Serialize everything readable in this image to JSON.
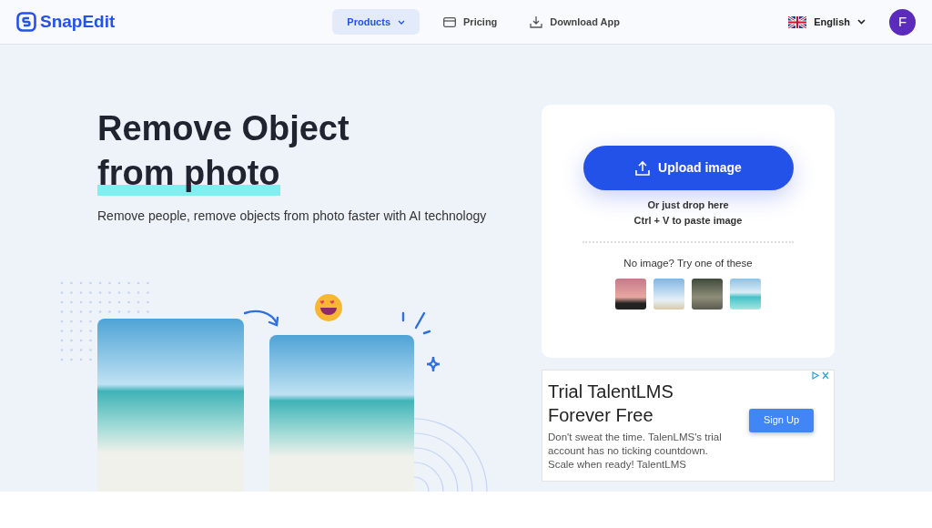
{
  "logo": {
    "text": "SnapEdit"
  },
  "nav": [
    {
      "label": "Products",
      "selected": true,
      "kind": "dropdown"
    },
    {
      "label": "Pricing",
      "selected": false,
      "kind": "card"
    },
    {
      "label": "Download App",
      "selected": false,
      "kind": "download"
    }
  ],
  "language": {
    "label": "English"
  },
  "avatar": {
    "initial": "F"
  },
  "hero": {
    "title_lines": [
      {
        "text": "Remove Object",
        "highlighted": false
      },
      {
        "text": "from photo",
        "highlighted": true
      }
    ],
    "subtitle": "Remove people, remove objects from photo faster with AI technology"
  },
  "upload": {
    "button": "Upload image",
    "hint_lines": [
      "Or just drop here",
      "Ctrl + V to paste image"
    ],
    "samples_label": "No image? Try one of these"
  },
  "ad": {
    "title_lines": [
      "Trial TalentLMS",
      "Forever Free"
    ],
    "body": "Don't sweat the time. TalenLMS's trial account has no ticking countdown. Scale when ready! TalentLMS",
    "button": "Sign Up"
  }
}
